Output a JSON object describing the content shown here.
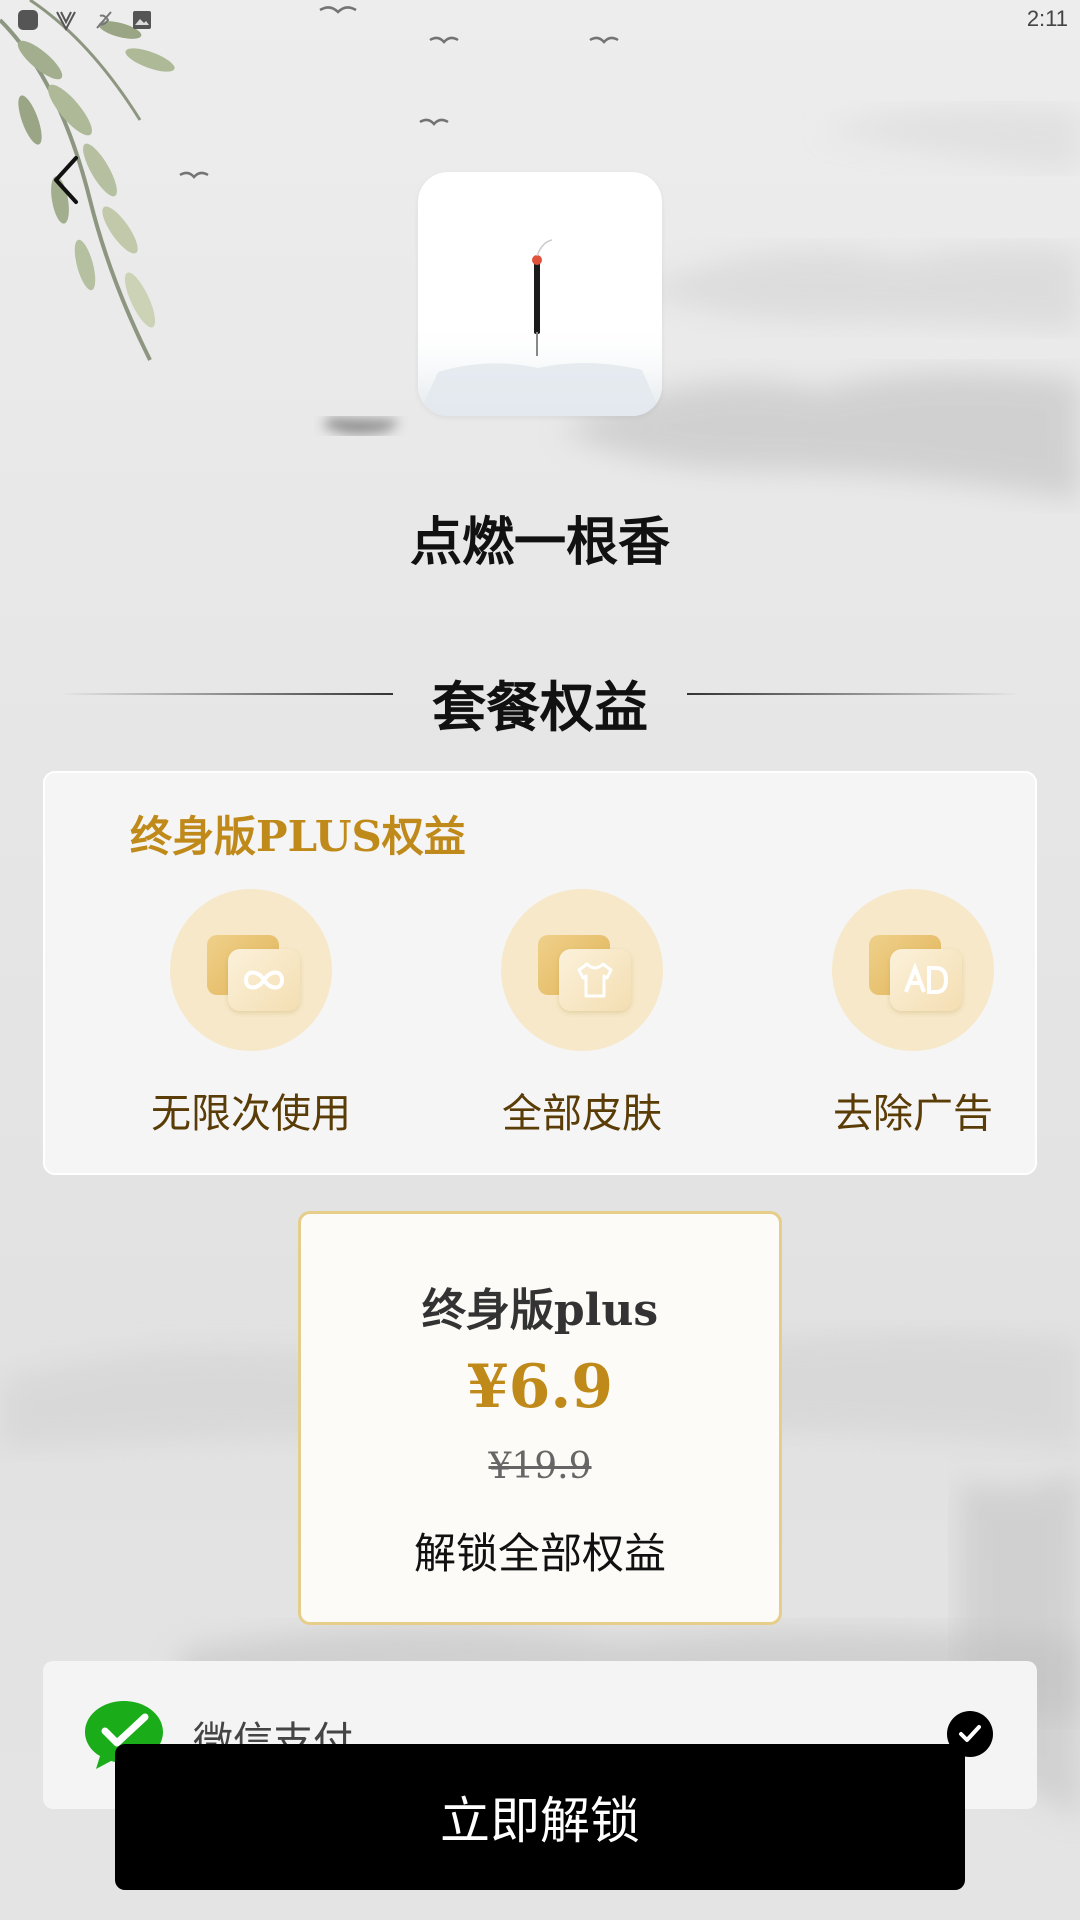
{
  "status_bar": {
    "time": "2:11",
    "icons": [
      "app-notification-icon",
      "v-app-icon",
      "crossed-bird-icon",
      "image-icon"
    ]
  },
  "header": {
    "back_icon": "chevron-left-icon"
  },
  "app": {
    "name": "点燃一根香",
    "icon": "incense-stick-icon"
  },
  "section": {
    "title": "套餐权益"
  },
  "benefits": {
    "title": "终身版PLUS权益",
    "items": [
      {
        "label": "无限次使用",
        "icon": "infinity-icon"
      },
      {
        "label": "全部皮肤",
        "icon": "shirt-icon"
      },
      {
        "label": "去除广告",
        "icon": "ad-icon"
      }
    ]
  },
  "plan": {
    "name": "终身版plus",
    "price": "¥6.9",
    "original_price": "¥19.9",
    "description": "解锁全部权益"
  },
  "payment": {
    "method": "微信支付",
    "icon": "wechat-pay-icon",
    "selected": true
  },
  "cta": {
    "label": "立即解锁"
  },
  "colors": {
    "accent_gold": "#c08a1a",
    "benefit_circle": "#f6e8c8",
    "plan_border": "#e6cd8a",
    "button": "#000000",
    "wechat_green": "#1aad19"
  }
}
